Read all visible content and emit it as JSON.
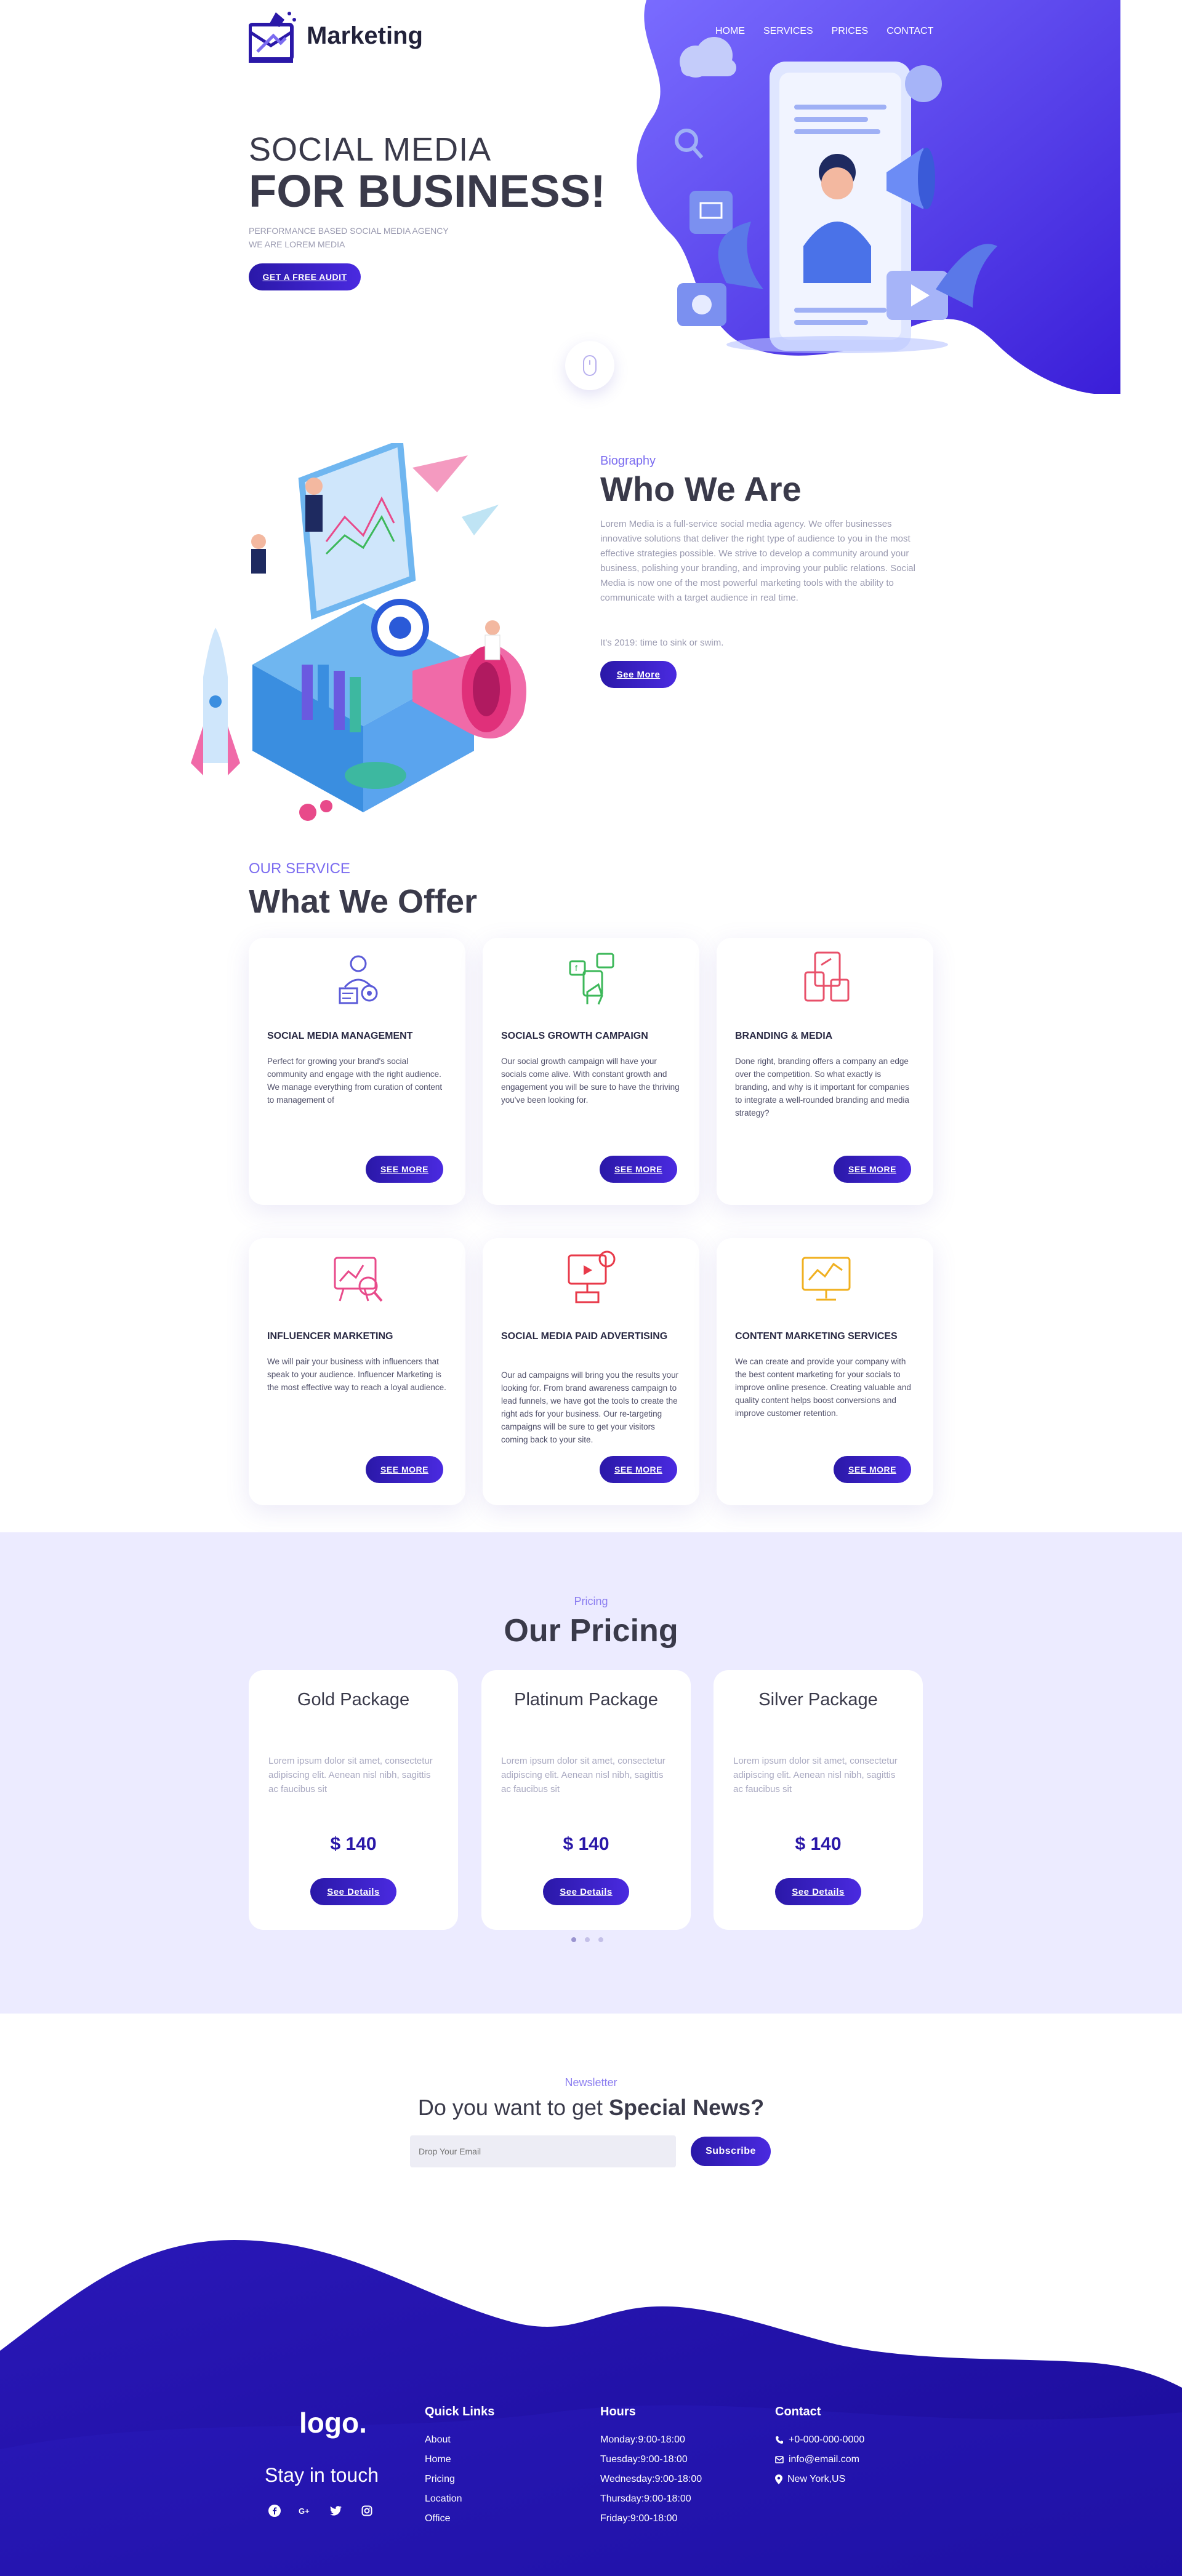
{
  "header": {
    "logo_text": "Marketing",
    "nav": [
      "HOME",
      "SERVICES",
      "PRICES",
      "CONTACT"
    ]
  },
  "hero": {
    "title_line1": "SOCIAL MEDIA",
    "title_line2": "FOR BUSINESS!",
    "subtitle_line1": "PERFORMANCE BASED SOCIAL MEDIA AGENCY",
    "subtitle_line2": "WE ARE LOREM MEDIA",
    "cta_label": "GET A FREE AUDIT"
  },
  "about": {
    "label": "Biography",
    "title": "Who We Are",
    "text": "Lorem Media is a full-service social media agency. We offer businesses innovative solutions that deliver the right type of audience to you in the most effective strategies possible. We strive to develop a community around your business, polishing your branding, and improving your public relations. Social Media is now one of the most powerful marketing tools with the ability to communicate with a target audience in real time.",
    "tagline": "It's 2019: time to sink or swim.",
    "button_label": "See More"
  },
  "services": {
    "label": "OUR SERVICE",
    "title": "What We Offer",
    "button_label": "SEE MORE",
    "items": [
      {
        "name": "SOCIAL MEDIA MANAGEMENT",
        "desc": "Perfect for growing your brand's social community and engage with the right audience. We manage everything from curation of content to management of",
        "icon": "social-management-icon",
        "color": "#5a5ad8"
      },
      {
        "name": "SOCIALS GROWTH CAMPAIGN",
        "desc": "Our social growth campaign will have your socials come alive. With constant growth and engagement you will be sure to have the thriving you've been looking for.",
        "icon": "growth-campaign-icon",
        "color": "#3db85a"
      },
      {
        "name": "BRANDING & MEDIA",
        "desc": "Done right, branding offers a company an edge over the competition. So what exactly is branding, and why is it important for companies to integrate a well-rounded branding and media strategy?",
        "icon": "branding-media-icon",
        "color": "#e8506a"
      },
      {
        "name": "INFLUENCER MARKETING",
        "desc": "We will pair your business with influencers that speak to your audience. Influencer Marketing is the most effective way to reach a loyal audience.",
        "icon": "influencer-icon",
        "color": "#e84a8a"
      },
      {
        "name": "SOCIAL MEDIA PAID ADVERTISING",
        "desc": "Our ad campaigns will bring you the results your looking for. From brand awareness campaign to lead funnels, we have got the tools to create the right ads for your business. Our re-targeting campaigns will be sure to get your visitors coming back to your site.",
        "icon": "paid-ads-icon",
        "color": "#e83a4a"
      },
      {
        "name": "CONTENT MARKETING SERVICES",
        "desc": "We can create and provide your company with the best content marketing for your socials to improve online presence. Creating valuable and quality content helps boost conversions and improve customer retention.",
        "icon": "content-marketing-icon",
        "color": "#f0b020"
      }
    ]
  },
  "pricing": {
    "label": "Pricing",
    "title": "Our Pricing",
    "button_label": "See Details",
    "plans": [
      {
        "name": "Gold Package",
        "desc": "Lorem ipsum dolor sit amet, consectetur adipiscing elit. Aenean nisl nibh, sagittis ac faucibus sit",
        "price": "$ 140"
      },
      {
        "name": "Platinum Package",
        "desc": "Lorem ipsum dolor sit amet, consectetur adipiscing elit. Aenean nisl nibh, sagittis ac faucibus sit",
        "price": "$ 140"
      },
      {
        "name": "Silver Package",
        "desc": "Lorem ipsum dolor sit amet, consectetur adipiscing elit. Aenean nisl nibh, sagittis ac faucibus sit",
        "price": "$ 140"
      }
    ]
  },
  "newsletter": {
    "label": "Newsletter",
    "title_plain": "Do you want to get ",
    "title_bold": "Special News?",
    "placeholder": "Drop Your Email",
    "button_label": "Subscribe"
  },
  "footer": {
    "logo": "logo.",
    "stay": "Stay in touch",
    "quick_links_title": "Quick Links",
    "quick_links": [
      "About",
      "Home",
      "Pricing",
      "Location",
      "Office"
    ],
    "hours_title": "Hours",
    "hours": [
      "Monday:9:00-18:00",
      "Tuesday:9:00-18:00",
      "Wednesday:9:00-18:00",
      "Thursday:9:00-18:00",
      "Friday:9:00-18:00"
    ],
    "contact_title": "Contact",
    "contact": [
      {
        "icon": "phone-icon",
        "text": "+0-000-000-0000"
      },
      {
        "icon": "mail-icon",
        "text": "info@email.com"
      },
      {
        "icon": "location-pin-icon",
        "text": "New York,US"
      }
    ]
  },
  "colors": {
    "primary": "#2a18a8",
    "accent": "#7b6cf0",
    "pricing_bg": "#ecebff",
    "footer": "#1a10a0"
  }
}
